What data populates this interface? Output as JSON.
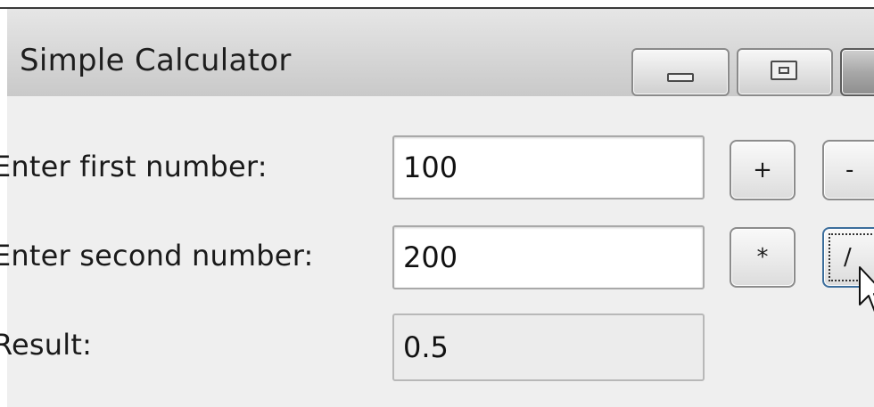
{
  "window": {
    "title": "Simple Calculator",
    "controls": [
      "minimize",
      "maximize",
      "close"
    ]
  },
  "form": {
    "first_label": "Enter first number:",
    "first_value": "100",
    "second_label": "Enter second number:",
    "second_value": "200",
    "result_label": "Result:",
    "result_value": "0.5"
  },
  "operations": {
    "add": "+",
    "subtract": "-",
    "multiply": "*",
    "divide": "/"
  },
  "icons": {
    "minimize": "minimize-icon",
    "maximize": "maximize-icon",
    "close": "close-icon",
    "cursor": "arrow-cursor-icon"
  },
  "colors": {
    "titlebar": "#d9d9d9",
    "client": "#efefef",
    "focus_border": "#3c6e9c"
  }
}
